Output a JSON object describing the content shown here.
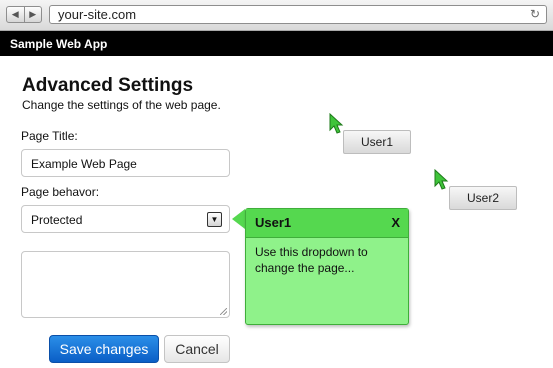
{
  "browser": {
    "back_glyph": "◀",
    "forward_glyph": "▶",
    "url": "your-site.com",
    "reload_glyph": "↻"
  },
  "app": {
    "name": "Sample Web App"
  },
  "page": {
    "title": "Advanced Settings",
    "subtitle": "Change the settings of the web page."
  },
  "form": {
    "page_title_label": "Page Title:",
    "page_title_value": "Example Web Page",
    "behavior_label": "Page behavor:",
    "behavior_value": "Protected",
    "dropdown_glyph": "▼",
    "textarea_value": "",
    "save_label": "Save changes",
    "cancel_label": "Cancel"
  },
  "tooltip": {
    "title": "User1",
    "close": "X",
    "body": "Use this dropdown to change the page..."
  },
  "users": [
    {
      "label": "User1",
      "cursor_color": "#3fc43a"
    },
    {
      "label": "User2",
      "cursor_color": "#3fc43a"
    }
  ],
  "colors": {
    "primary_button": "#1575d8",
    "tooltip_bg": "#8ff28a",
    "tooltip_header": "#55d84f",
    "appbar": "#000000"
  }
}
